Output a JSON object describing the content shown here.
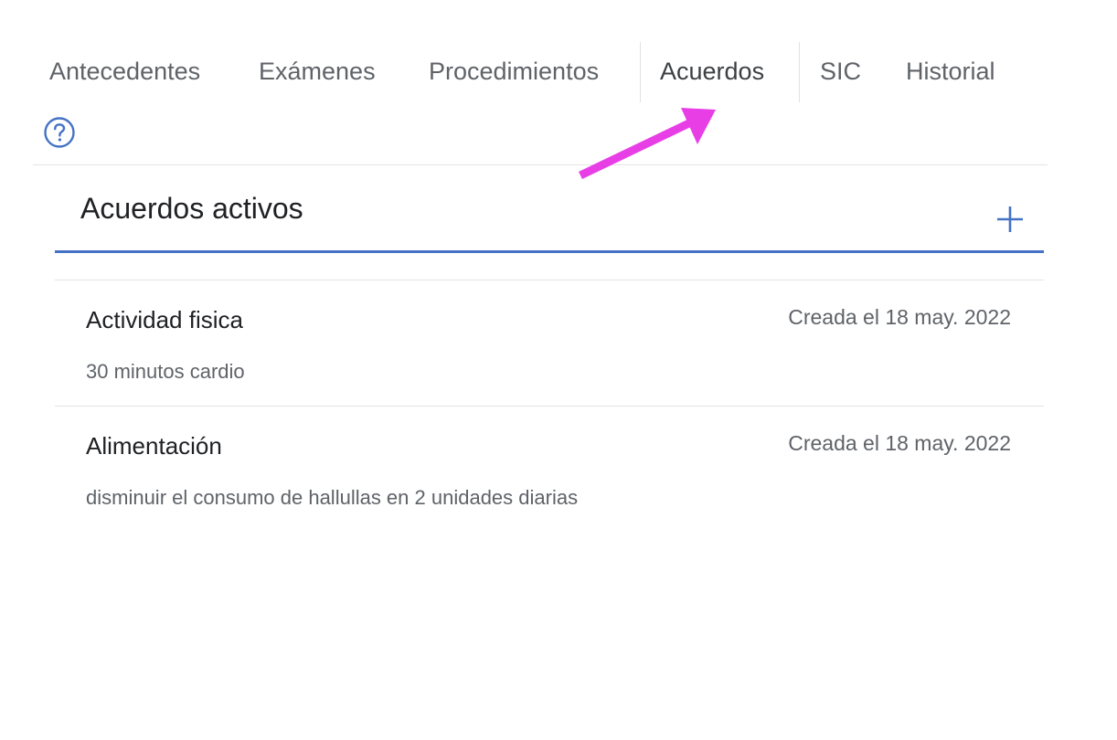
{
  "tabs": [
    {
      "label": "Antecedentes",
      "active": false
    },
    {
      "label": "Exámenes",
      "active": false
    },
    {
      "label": "Procedimientos",
      "active": false
    },
    {
      "label": "Acuerdos",
      "active": true
    },
    {
      "label": "SIC",
      "active": false
    },
    {
      "label": "Historial",
      "active": false
    }
  ],
  "help": {
    "icon": "help-circle-icon"
  },
  "section": {
    "title": "Acuerdos activos",
    "add_icon": "plus-icon"
  },
  "agreements": [
    {
      "title": "Actividad fisica",
      "created": "Creada el 18 may. 2022",
      "description": "30 minutos cardio"
    },
    {
      "title": "Alimentación",
      "created": "Creada el 18 may. 2022",
      "description": "disminuir el consumo de hallullas en 2 unidades diarias"
    }
  ],
  "colors": {
    "accent": "#4472c4",
    "annotation_arrow": "#e83ee6",
    "muted_text": "#5f6368"
  }
}
